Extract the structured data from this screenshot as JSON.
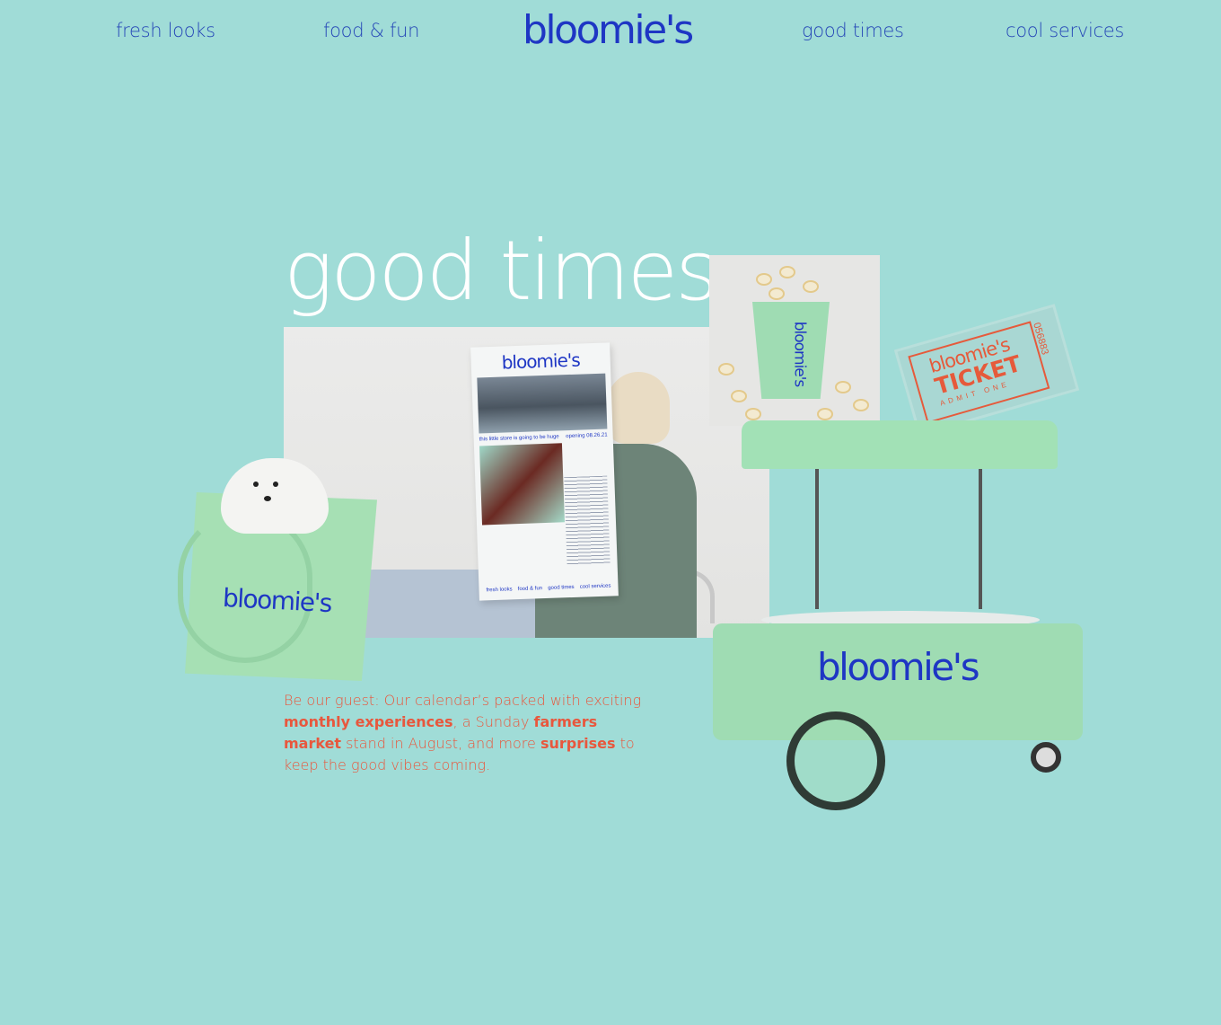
{
  "nav": {
    "items": [
      "fresh looks",
      "food & fun",
      "good times",
      "cool services"
    ],
    "logo": "bloomie's"
  },
  "hero": {
    "headline": "good times"
  },
  "newspaper": {
    "logo": "bloomie's",
    "caption_left": "this little store is going to be huge",
    "caption_right": "opening 08.26.21",
    "footer": [
      "fresh looks",
      "food & fun",
      "good times",
      "cool services"
    ]
  },
  "popcorn": {
    "cup_logo": "bloomie's"
  },
  "ticket": {
    "logo": "bloomie's",
    "word": "TICKET",
    "admit": "ADMIT ONE",
    "number": "056883"
  },
  "cart": {
    "logo": "bloomie's"
  },
  "bag": {
    "logo": "bloomie's"
  },
  "copy": {
    "part1": "Be our guest: Our calendar’s packed with exciting ",
    "bold1": "monthly experiences",
    "part2": ", a Sunday ",
    "bold2": "farmers market",
    "part3": " stand in August, and more ",
    "bold3": "surprises",
    "part4": " to keep the good vibes coming."
  },
  "colors": {
    "background": "#a0dcd7",
    "brand_blue": "#1e36c4",
    "accent_coral": "#e8573d",
    "mint": "#9fdcb3"
  }
}
